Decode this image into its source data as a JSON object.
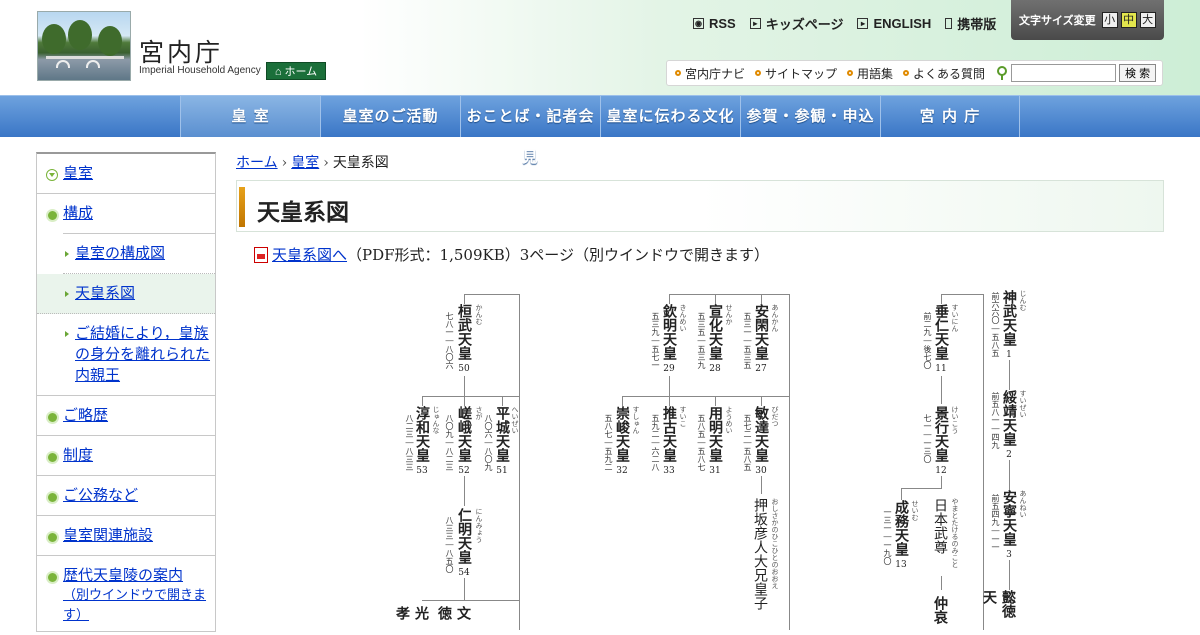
{
  "header": {
    "site_title": "宮内庁",
    "site_subtitle": "Imperial Household Agency",
    "home_label": "ホーム",
    "top_links": [
      {
        "label": "RSS",
        "icon": "rss-icon"
      },
      {
        "label": "キッズページ",
        "icon": "arrow-icon"
      },
      {
        "label": "ENGLISH",
        "icon": "arrow-icon"
      },
      {
        "label": "携帯版",
        "icon": "mobile-icon"
      }
    ],
    "font_size": {
      "label": "文字サイズ変更",
      "options": [
        "小",
        "中",
        "大"
      ],
      "selected": "中"
    },
    "sub_links": [
      "宮内庁ナビ",
      "サイトマップ",
      "用語集",
      "よくある質問"
    ],
    "search_button": "検 索"
  },
  "nav": [
    "皇 室",
    "皇室のご活動",
    "おことば・記者会見",
    "皇室に伝わる文化",
    "参賀・参観・申込",
    "宮 内 庁"
  ],
  "sidebar": {
    "top": "皇室",
    "section": "構成",
    "subs": [
      "皇室の構成図",
      "天皇系図",
      "ご結婚により，皇族の身分を離れられた内親王"
    ],
    "items": [
      "ご略歴",
      "制度",
      "ご公務など",
      "皇室関連施設"
    ],
    "last_label": "歴代天皇陵の案内",
    "last_note": "（別ウインドウで開きます）"
  },
  "breadcrumb": [
    "ホーム",
    "皇室",
    "天皇系図"
  ],
  "page_title": "天皇系図",
  "pdf": {
    "link": "天皇系図へ",
    "info": "（PDF形式：1,509KB）3ページ（別ウインドウで開きます）"
  },
  "emperors": [
    {
      "id": "kanmu",
      "name": "桓武天皇",
      "no": "50",
      "years": "七八一―八〇六",
      "ruby": "かんむ"
    },
    {
      "id": "junna",
      "name": "淳和天皇",
      "no": "53",
      "years": "八二三―八三三",
      "ruby": "じゅんな"
    },
    {
      "id": "saga",
      "name": "嵯峨天皇",
      "no": "52",
      "years": "八〇九―八二三",
      "ruby": "さが"
    },
    {
      "id": "heizei",
      "name": "平城天皇",
      "no": "51",
      "years": "八〇六―八〇九",
      "ruby": "へいぜい"
    },
    {
      "id": "ninmyo",
      "name": "仁明天皇",
      "no": "54",
      "years": "八三三―八五〇",
      "ruby": "にんみょう"
    },
    {
      "id": "kinmei",
      "name": "欽明天皇",
      "no": "29",
      "years": "五三九―五七一",
      "ruby": "きんめい"
    },
    {
      "id": "senka",
      "name": "宣化天皇",
      "no": "28",
      "years": "五三五―五三九",
      "ruby": "せんか"
    },
    {
      "id": "ankan",
      "name": "安閑天皇",
      "no": "27",
      "years": "五三一―五三五",
      "ruby": "あんかん"
    },
    {
      "id": "sushun",
      "name": "崇峻天皇",
      "no": "32",
      "years": "五八七―五九二",
      "ruby": "すしゅん"
    },
    {
      "id": "suiko",
      "name": "推古天皇",
      "no": "33",
      "years": "五九二―六二八",
      "ruby": "すいこ"
    },
    {
      "id": "yomei",
      "name": "用明天皇",
      "no": "31",
      "years": "五八五―五八七",
      "ruby": "ようめい"
    },
    {
      "id": "bidatsu",
      "name": "敏達天皇",
      "no": "30",
      "years": "五七二―五八五",
      "ruby": "びだつ"
    },
    {
      "id": "suinin",
      "name": "垂仁天皇",
      "no": "11",
      "years": "前二九―後七〇",
      "ruby": "すいにん"
    },
    {
      "id": "keiko",
      "name": "景行天皇",
      "no": "12",
      "years": "七一―一三〇",
      "ruby": "けいこう"
    },
    {
      "id": "seimu",
      "name": "成務天皇",
      "no": "13",
      "years": "一三一―一九〇",
      "ruby": "せいむ"
    },
    {
      "id": "jinmu",
      "name": "神武天皇",
      "no": "1",
      "years": "前六六〇―五八五",
      "ruby": "じんむ"
    },
    {
      "id": "suizei",
      "name": "綏靖天皇",
      "no": "2",
      "years": "前五八一―四九",
      "ruby": "すいぜい"
    },
    {
      "id": "annei",
      "name": "安寧天皇",
      "no": "3",
      "years": "前五四九―一一",
      "ruby": "あんねい"
    }
  ],
  "persons": [
    {
      "id": "oshisaka",
      "name": "押坂彦人大兄皇子",
      "ruby": "おしさかのひこひとのおおえ"
    },
    {
      "id": "yamatotakeru",
      "name": "日本武尊",
      "ruby": "やまとたけるのみこと"
    }
  ],
  "partial_names": [
    {
      "id": "kouko",
      "text": "光孝"
    },
    {
      "id": "montoku",
      "text": "文徳"
    },
    {
      "id": "chuai",
      "text": "仲哀"
    },
    {
      "id": "itoku",
      "text": "懿徳天"
    }
  ]
}
